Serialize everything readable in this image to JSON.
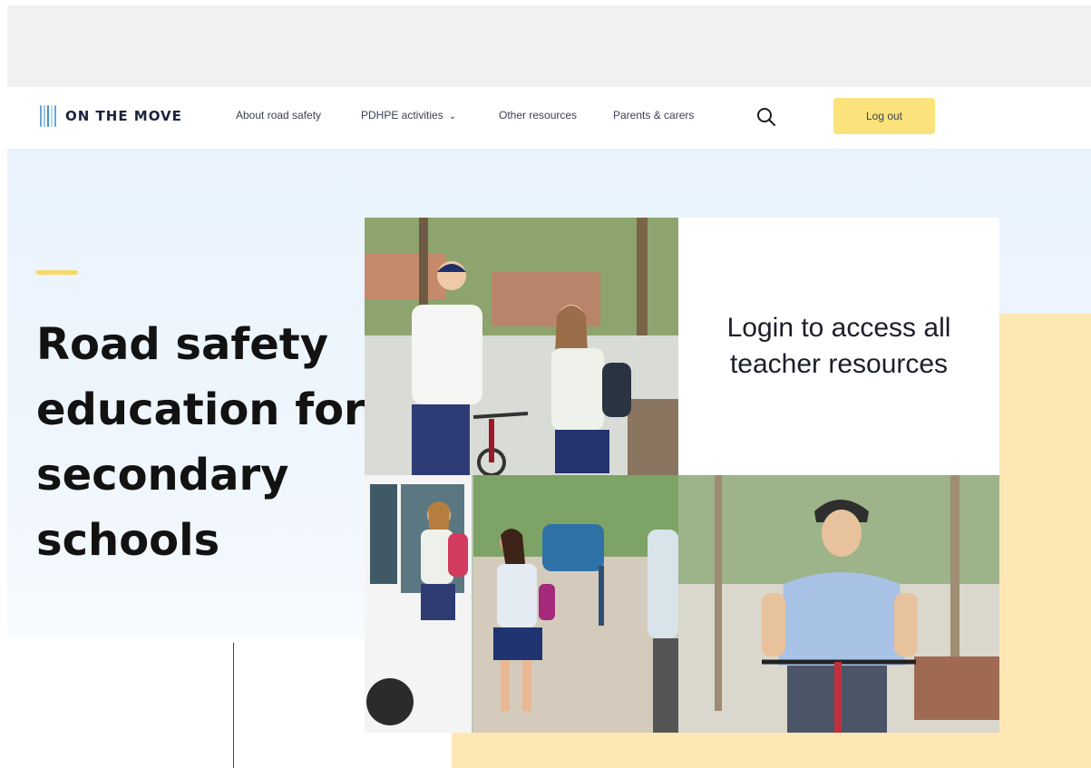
{
  "brand": {
    "name": "ON THE MOVE"
  },
  "nav": {
    "links": [
      "About road safety",
      "PDHPE activities",
      "Other resources",
      "Parents & carers"
    ],
    "search_icon": "search-icon",
    "logout_label": "Log out"
  },
  "hero": {
    "title": "Road safety education for secondary schools",
    "login_prompt": "Login to access all teacher resources"
  },
  "colors": {
    "accent_yellow": "#fbe27a",
    "hero_bg": "#e9f3fd",
    "block_yellow": "#fde8b5",
    "text_dark": "#121212"
  }
}
